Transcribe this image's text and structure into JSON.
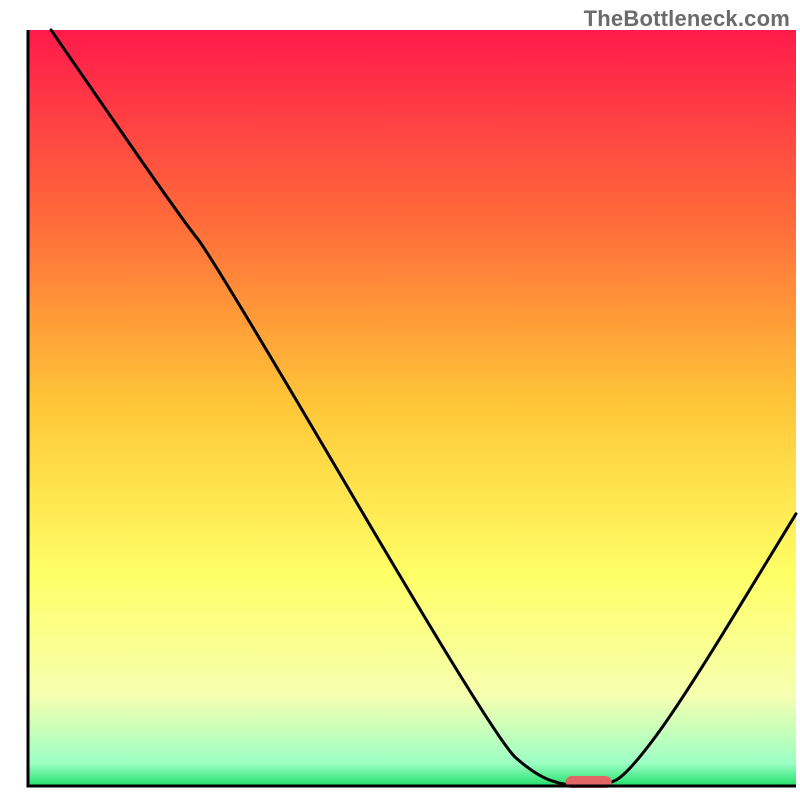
{
  "watermark": "TheBottleneck.com",
  "chart_data": {
    "type": "line",
    "title": "",
    "xlabel": "",
    "ylabel": "",
    "xlim": [
      0,
      100
    ],
    "ylim": [
      0,
      100
    ],
    "grid": false,
    "legend": false,
    "background_gradient": {
      "stops": [
        {
          "offset": 0.0,
          "color": "#ff1a4b"
        },
        {
          "offset": 0.25,
          "color": "#ff6a3a"
        },
        {
          "offset": 0.5,
          "color": "#ffc838"
        },
        {
          "offset": 0.72,
          "color": "#ffff66"
        },
        {
          "offset": 0.88,
          "color": "#f6ffb0"
        },
        {
          "offset": 0.97,
          "color": "#9cffc4"
        },
        {
          "offset": 1.0,
          "color": "#22e06a"
        }
      ]
    },
    "series": [
      {
        "name": "bottleneck-curve",
        "color": "#000000",
        "points": [
          {
            "x": 3,
            "y": 100
          },
          {
            "x": 20,
            "y": 75
          },
          {
            "x": 24,
            "y": 70
          },
          {
            "x": 61,
            "y": 6
          },
          {
            "x": 66,
            "y": 1.5
          },
          {
            "x": 70,
            "y": 0
          },
          {
            "x": 75,
            "y": 0
          },
          {
            "x": 78,
            "y": 1.5
          },
          {
            "x": 85,
            "y": 11
          },
          {
            "x": 100,
            "y": 36
          }
        ]
      }
    ],
    "marker": {
      "name": "optimal-region",
      "x": 73,
      "y": 0,
      "width": 6,
      "color": "#e06666"
    },
    "axes": {
      "color": "#000000",
      "thickness_px": 3
    }
  }
}
